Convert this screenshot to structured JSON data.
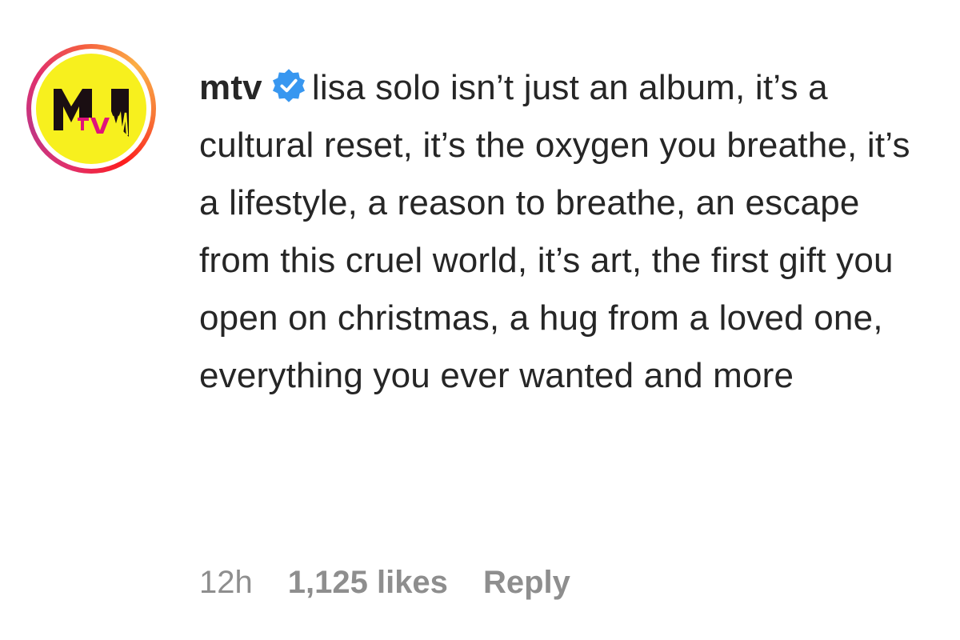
{
  "comment": {
    "avatar": {
      "icon": "mtv-logo-icon",
      "logo_text": "MTV",
      "ring_colors": [
        "#e1306c",
        "#f56040",
        "#fcaf45"
      ],
      "background_color": "#f7f01e"
    },
    "username": "mtv",
    "verified_icon": "verified-badge-icon",
    "verified_color": "#3897f0",
    "text": "lisa solo isn’t just an album, it’s a cultural reset, it’s the oxygen you breathe, it’s a lifestyle, a reason to breathe, an escape from this cruel world, it’s art, the first gift you open on christmas, a hug from a loved one, everything you ever wanted and more",
    "timestamp": "12h",
    "likes": "1,125 likes",
    "reply_label": "Reply"
  }
}
